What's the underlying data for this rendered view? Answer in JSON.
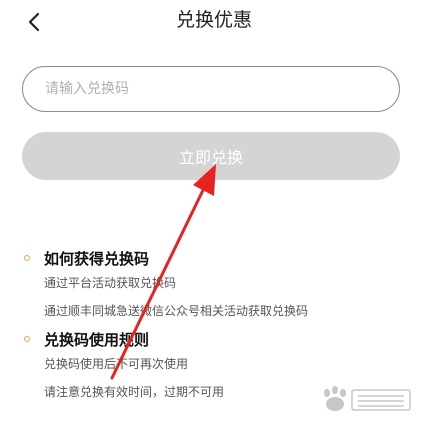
{
  "nav": {
    "title": "兑换优惠"
  },
  "form": {
    "input_placeholder": "请输入兑换码",
    "input_value": "",
    "submit_label": "立即兑换"
  },
  "sections": [
    {
      "heading": "如何获得兑换码",
      "lines": [
        "通过平台活动获取兑换码",
        "通过顺丰同城急送微信公众号相关活动获取兑换码"
      ]
    },
    {
      "heading": "兑换码使用规则",
      "lines": [
        "兑换码使用后不可再次使用",
        "请注意兑换有效时间，过期不可用"
      ]
    }
  ],
  "colors": {
    "accent": "#f0a34a",
    "button_disabled": "#d4d4d4",
    "annotation": "#e8231f"
  },
  "icons": {
    "back": "chevron-left-icon",
    "bullet": "circle-outline-icon"
  }
}
